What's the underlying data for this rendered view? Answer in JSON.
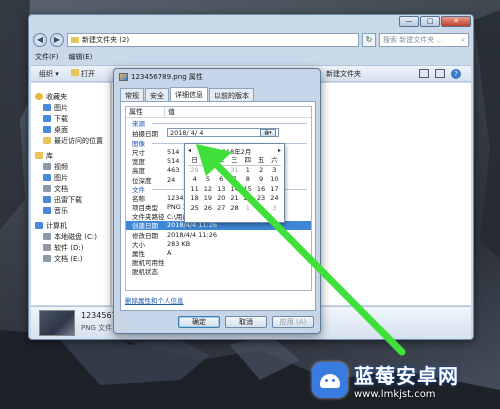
{
  "explorer": {
    "breadcrumb": "新建文件夹 (2)",
    "search_placeholder": "搜索 新建文件夹 ...",
    "window_buttons": [
      "—",
      "□",
      "✕"
    ],
    "menu": [
      "文件(F)",
      "编辑(E)"
    ],
    "toolbar": {
      "organize": "组织 ▾",
      "open": "打开",
      "new_folder": "新建文件夹"
    },
    "nav": [
      {
        "label": "收藏夹",
        "group": true,
        "icon": "star-icon"
      },
      {
        "label": "图片",
        "icon": "pictures-icon"
      },
      {
        "label": "下载",
        "icon": "download-icon"
      },
      {
        "label": "桌面",
        "icon": "desktop-icon"
      },
      {
        "label": "最近访问的位置",
        "icon": "recent-icon"
      },
      {
        "label": "库",
        "group": true,
        "icon": "library-icon"
      },
      {
        "label": "视频",
        "icon": "video-icon"
      },
      {
        "label": "图片",
        "icon": "pictures-icon"
      },
      {
        "label": "文档",
        "icon": "document-icon"
      },
      {
        "label": "迅雷下载",
        "icon": "thunder-download-icon"
      },
      {
        "label": "音乐",
        "icon": "music-icon"
      },
      {
        "label": "计算机",
        "group": true,
        "icon": "computer-icon"
      },
      {
        "label": "本地磁盘 (C:)",
        "icon": "disk-icon"
      },
      {
        "label": "软件 (D:)",
        "icon": "disk-icon"
      },
      {
        "label": "文档 (E:)",
        "icon": "disk-icon"
      }
    ],
    "details": {
      "name": "12345678",
      "type": "PNG 文件"
    }
  },
  "dialog": {
    "title": "123456789.png 属性",
    "tabs": [
      "常规",
      "安全",
      "详细信息",
      "以前的版本"
    ],
    "active_tab": 2,
    "header": {
      "property": "属性",
      "value": "值"
    },
    "source_section": "来源",
    "shoot_date_label": "拍摄日期",
    "shoot_date_value": "2018/ 4/ 4",
    "image_section": "图像",
    "image_rows": [
      {
        "k": "尺寸",
        "v": "514"
      },
      {
        "k": "宽度",
        "v": "514"
      },
      {
        "k": "高度",
        "v": "463"
      },
      {
        "k": "位深度",
        "v": "24"
      }
    ],
    "file_section": "文件",
    "file_rows": [
      {
        "k": "名称",
        "v": "12345"
      },
      {
        "k": "项目类型",
        "v": "PNG 3"
      },
      {
        "k": "文件夹路径",
        "v": "C:\\用户\\Administrator\\桌面\\新"
      },
      {
        "k": "创建日期",
        "v": "2018/4/4 11:26",
        "selected": true
      },
      {
        "k": "修改日期",
        "v": "2018/4/4 11:26"
      },
      {
        "k": "大小",
        "v": "283 KB"
      },
      {
        "k": "属性",
        "v": "A"
      },
      {
        "k": "脱机可用性",
        "v": ""
      },
      {
        "k": "脱机状态",
        "v": ""
      }
    ],
    "remove_link": "删除属性和个人信息",
    "buttons": {
      "ok": "确定",
      "cancel": "取消",
      "apply": "应用 (A)"
    }
  },
  "calendar": {
    "title": "2018年2月",
    "prev": "◂",
    "next": "▸",
    "dow": [
      "日",
      "一",
      "二",
      "三",
      "四",
      "五",
      "六"
    ],
    "weeks": [
      [
        "28",
        "29",
        "30",
        "31",
        "1",
        "2",
        "3"
      ],
      [
        "4",
        "5",
        "6",
        "7",
        "8",
        "9",
        "10"
      ],
      [
        "11",
        "12",
        "13",
        "14",
        "15",
        "16",
        "17"
      ],
      [
        "18",
        "19",
        "20",
        "21",
        "22",
        "23",
        "24"
      ],
      [
        "25",
        "26",
        "27",
        "28",
        "1",
        "2",
        "3"
      ]
    ]
  },
  "watermark": {
    "name": "蓝莓安卓网",
    "url": "www.lmkjst.com"
  },
  "colors": {
    "arrow": "#3fe03a",
    "selection": "#3d87d6",
    "link": "#1c58b0"
  }
}
